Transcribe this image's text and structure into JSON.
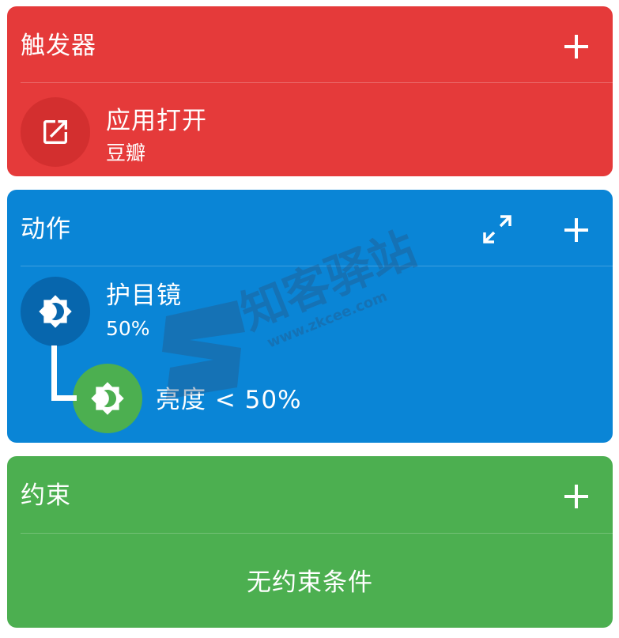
{
  "trigger": {
    "title": "触发器",
    "item": {
      "title": "应用打开",
      "subtitle": "豆瓣",
      "icon": "open-in-new-icon"
    },
    "add_icon": "plus-icon",
    "color": "#e53a3a"
  },
  "action": {
    "title": "动作",
    "expand_icon": "expand-icon",
    "add_icon": "plus-icon",
    "item": {
      "title": "护目镜",
      "subtitle": "50%",
      "icon": "brightness-icon"
    },
    "condition": {
      "text": "亮度 < 50%",
      "icon": "brightness-icon"
    },
    "color": "#0a85d6"
  },
  "constraint": {
    "title": "约束",
    "add_icon": "plus-icon",
    "empty_text": "无约束条件",
    "color": "#4caf50"
  },
  "watermark": {
    "cn": "知客驿站",
    "url": "www.zkcee.com"
  }
}
